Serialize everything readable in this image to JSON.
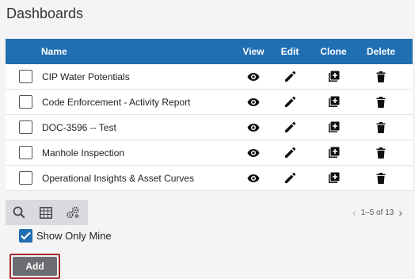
{
  "page": {
    "title": "Dashboards"
  },
  "table": {
    "headers": {
      "name": "Name",
      "view": "View",
      "edit": "Edit",
      "clone": "Clone",
      "delete": "Delete"
    },
    "rows": [
      {
        "name": "CIP Water Potentials"
      },
      {
        "name": "Code Enforcement - Activity Report"
      },
      {
        "name": "DOC-3596 -- Test"
      },
      {
        "name": "Manhole Inspection"
      },
      {
        "name": "Operational Insights & Asset Curves"
      }
    ]
  },
  "toolbar": {
    "icons": [
      "search-icon",
      "grid-icon",
      "gears-icon"
    ]
  },
  "pager": {
    "range": "1–5 of 13",
    "prev": "‹",
    "next": "›"
  },
  "filter": {
    "show_only_mine_label": "Show Only Mine",
    "checked": true
  },
  "actions": {
    "add_label": "Add"
  },
  "colors": {
    "header": "#1f6fb2",
    "add_button": "#6b6d70",
    "focus_outline": "#a32a2a"
  }
}
